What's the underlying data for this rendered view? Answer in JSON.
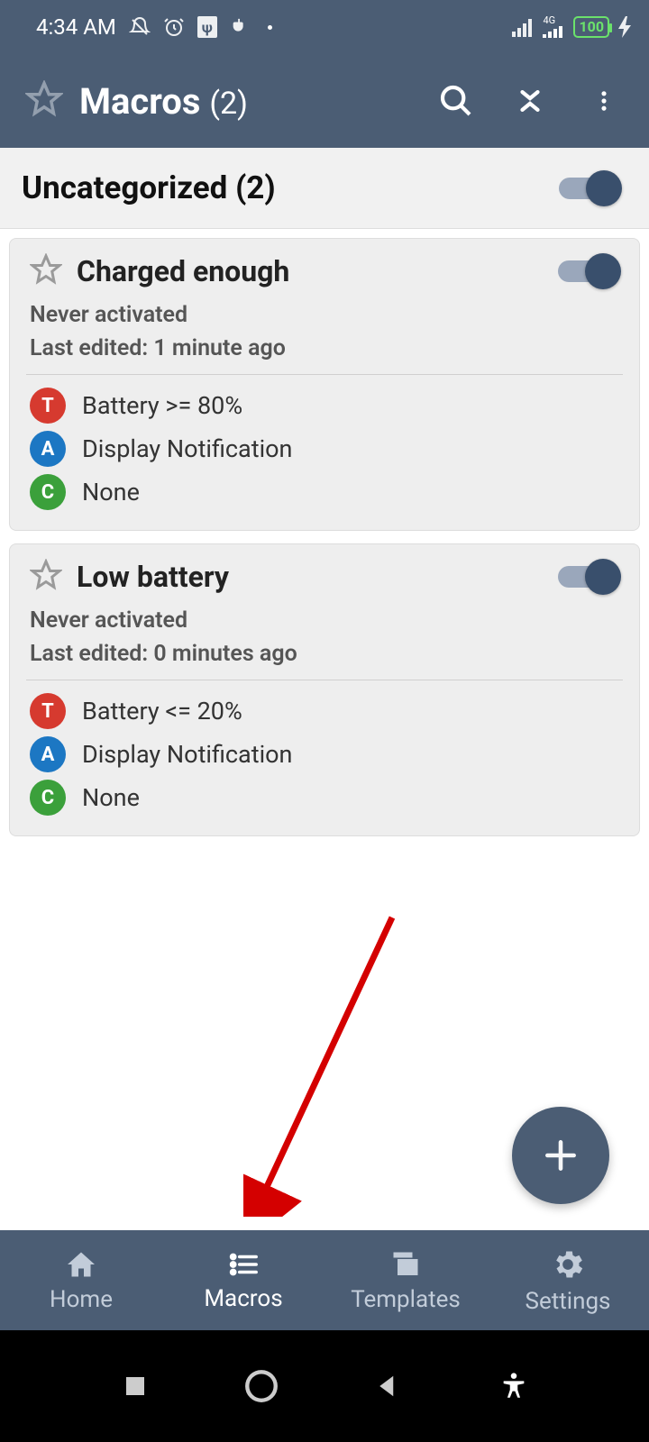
{
  "statusbar": {
    "time": "4:34 AM",
    "battery": "100"
  },
  "appbar": {
    "title": "Macros",
    "count": "(2)"
  },
  "category": {
    "title": "Uncategorized (2)"
  },
  "macros": [
    {
      "name": "Charged enough",
      "never_activated": "Never activated",
      "last_edited": "Last edited: 1 minute ago",
      "trigger_label": "T",
      "trigger_text": "Battery >= 80%",
      "action_label": "A",
      "action_text": "Display Notification",
      "constraint_label": "C",
      "constraint_text": "None"
    },
    {
      "name": "Low battery",
      "never_activated": "Never activated",
      "last_edited": "Last edited: 0 minutes ago",
      "trigger_label": "T",
      "trigger_text": "Battery <= 20%",
      "action_label": "A",
      "action_text": "Display Notification",
      "constraint_label": "C",
      "constraint_text": "None"
    }
  ],
  "nav": {
    "home": "Home",
    "macros": "Macros",
    "templates": "Templates",
    "settings": "Settings"
  }
}
